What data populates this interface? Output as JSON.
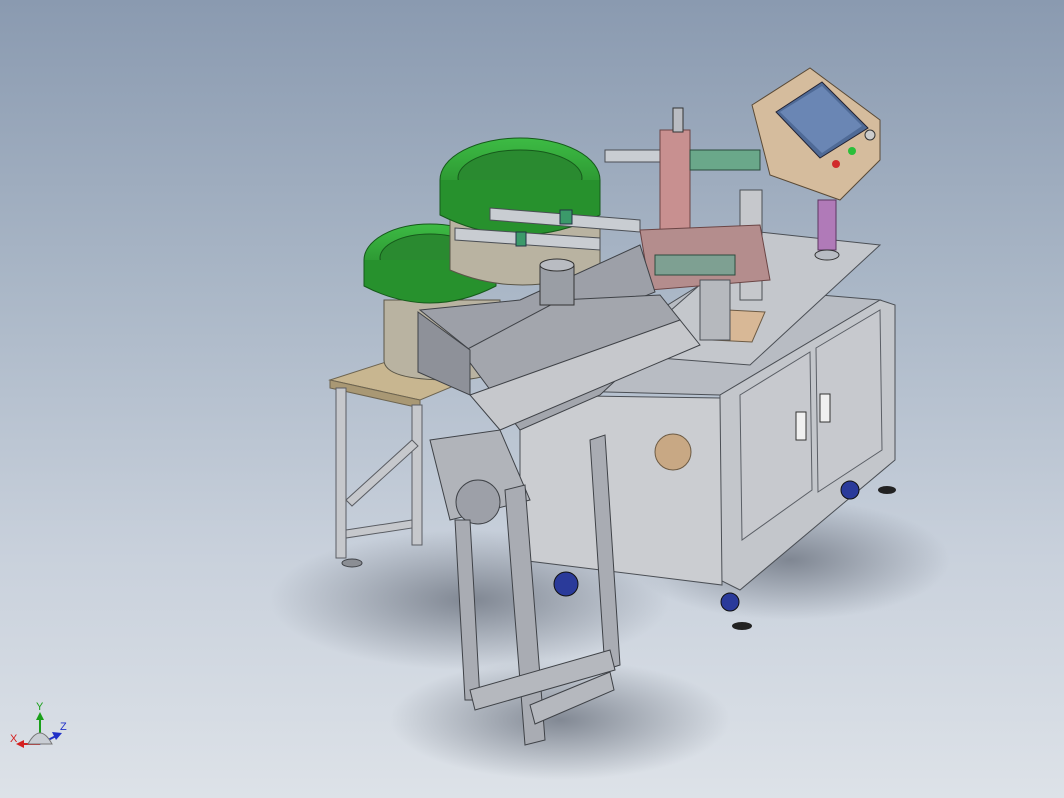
{
  "viewport": {
    "colors": {
      "background_top": "#8a9ab0",
      "background_bottom": "#dde2e8",
      "frame": "#b4b7bd",
      "panel": "#c6c8cc",
      "bowl": "#2f9a35",
      "panel_box": "#d1b89a",
      "control_tube": "#b07ab8"
    }
  },
  "model": {
    "components": [
      "vibratory-bowl-feeder-large",
      "vibratory-bowl-feeder-small",
      "control-panel-hmi",
      "linear-feeder-track",
      "assembly-station",
      "machine-cabinet",
      "discharge-conveyor",
      "caster-wheels",
      "leveling-feet"
    ]
  },
  "triad": {
    "x_label": "X",
    "y_label": "Y",
    "z_label": "Z",
    "x_color": "#d42020",
    "y_color": "#1aa01a",
    "z_color": "#2030c8"
  }
}
